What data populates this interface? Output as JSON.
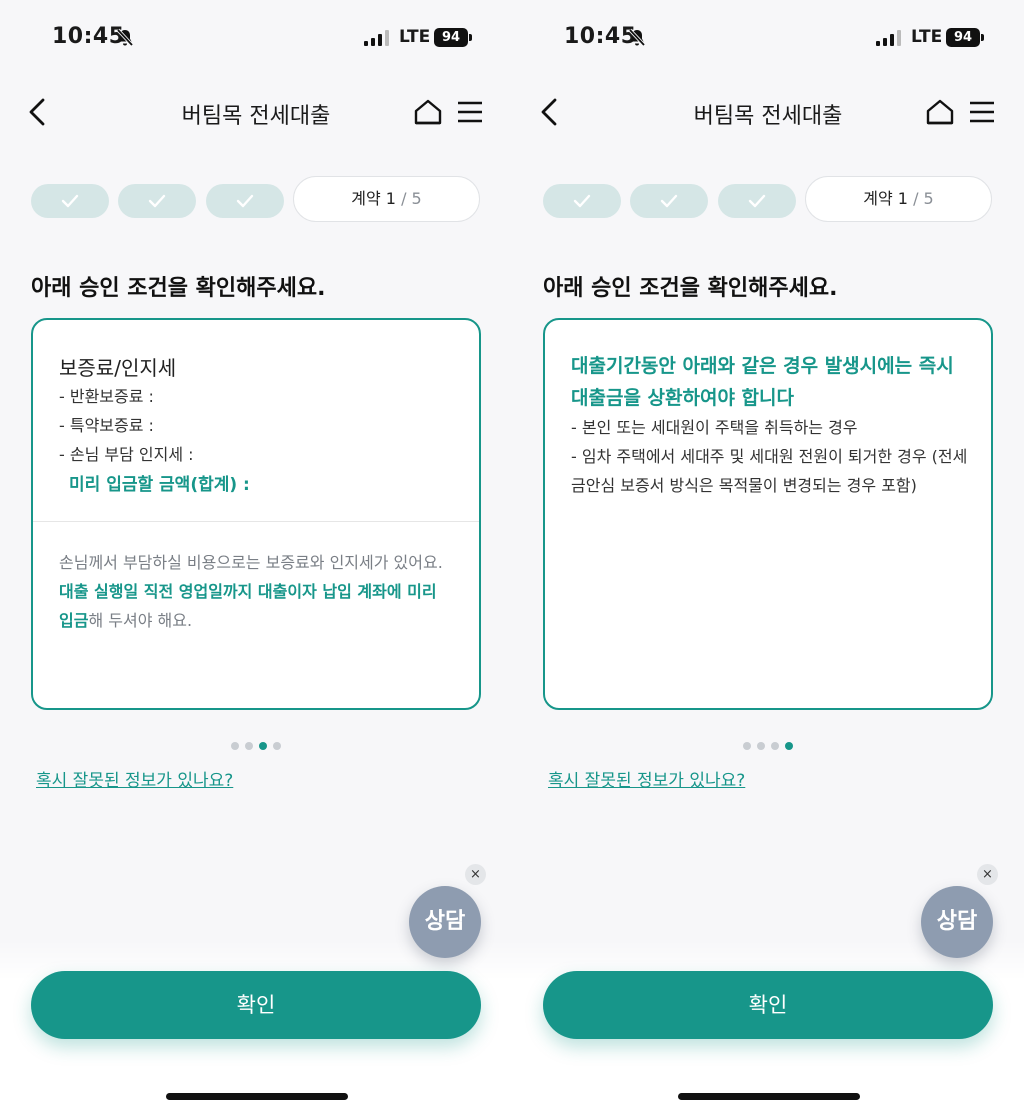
{
  "screens": [
    {
      "status": {
        "time": "10:45",
        "network": "LTE",
        "battery": "94"
      },
      "header": {
        "title": "버팀목 전세대출"
      },
      "stepper": {
        "current_label": "계약 1",
        "total": " / 5"
      },
      "heading": "아래 승인 조건을 확인해주세요.",
      "card": {
        "title": "보증료/인지세",
        "items": [
          "- 반환보증료 :",
          "- 특약보증료 :",
          "- 손님 부담 인지세 :"
        ],
        "total_label": "미리 입금할 금액(합계) :",
        "note_pre": "손님께서 부담하실 비용으로는 보증료와 인지세가 있어요. ",
        "note_hl": "대출 실행일 직전 영업일까지 대출이자 납입 계좌에 미리 입금",
        "note_post": "해 두셔야 해요."
      },
      "pagination": {
        "active_index": 2,
        "count": 4
      },
      "link": "혹시 잘못된 정보가 있나요?",
      "chat": {
        "label": "상담",
        "close": "×"
      },
      "confirm": "확인"
    },
    {
      "status": {
        "time": "10:45",
        "network": "LTE",
        "battery": "94"
      },
      "header": {
        "title": "버팀목 전세대출"
      },
      "stepper": {
        "current_label": "계약 1",
        "total": " / 5"
      },
      "heading": "아래 승인 조건을 확인해주세요.",
      "card": {
        "title": "대출기간동안 아래와 같은 경우 발생시에는 즉시 대출금을 상환하여야 합니다",
        "items": [
          "- 본인 또는 세대원이 주택을 취득하는 경우",
          "- 임차 주택에서 세대주 및 세대원 전원이 퇴거한 경우 (전세금안심 보증서 방식은 목적물이 변경되는 경우 포함)"
        ]
      },
      "pagination": {
        "active_index": 3,
        "count": 4
      },
      "link": "혹시 잘못된 정보가 있나요?",
      "chat": {
        "label": "상담",
        "close": "×"
      },
      "confirm": "확인"
    }
  ],
  "colors": {
    "accent": "#17968a",
    "step_done": "#d5e6e6",
    "chat": "#8e9cb0"
  },
  "icons": [
    "bell-off-icon",
    "signal-icon",
    "back-chevron-icon",
    "home-icon",
    "menu-icon",
    "check-icon",
    "close-icon"
  ]
}
